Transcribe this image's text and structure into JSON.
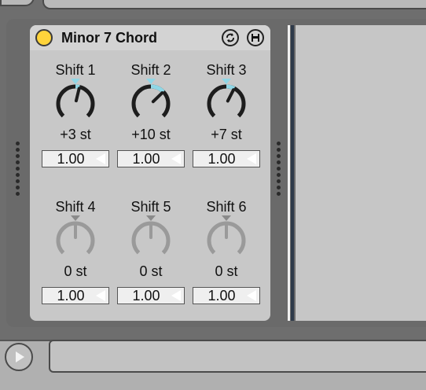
{
  "device": {
    "title": "Minor 7 Chord",
    "power_color": "#ffd43b",
    "accent_color": "#8fd7e6",
    "params_top": [
      {
        "label": "Shift 1",
        "value": "+3 st",
        "velocity": "1.00",
        "knob_fraction": 0.55
      },
      {
        "label": "Shift 2",
        "value": "+10 st",
        "velocity": "1.00",
        "knob_fraction": 0.67
      },
      {
        "label": "Shift 3",
        "value": "+7 st",
        "velocity": "1.00",
        "knob_fraction": 0.6
      }
    ],
    "params_bottom": [
      {
        "label": "Shift 4",
        "value": "0 st",
        "velocity": "1.00",
        "knob_fraction": 0.5
      },
      {
        "label": "Shift 5",
        "value": "0 st",
        "velocity": "1.00",
        "knob_fraction": 0.5
      },
      {
        "label": "Shift 6",
        "value": "0 st",
        "velocity": "1.00",
        "knob_fraction": 0.5
      }
    ]
  },
  "icons": {
    "power": "power-toggle-icon",
    "hot_swap": "hot-swap-icon",
    "save": "save-preset-icon",
    "play": "play-icon"
  }
}
